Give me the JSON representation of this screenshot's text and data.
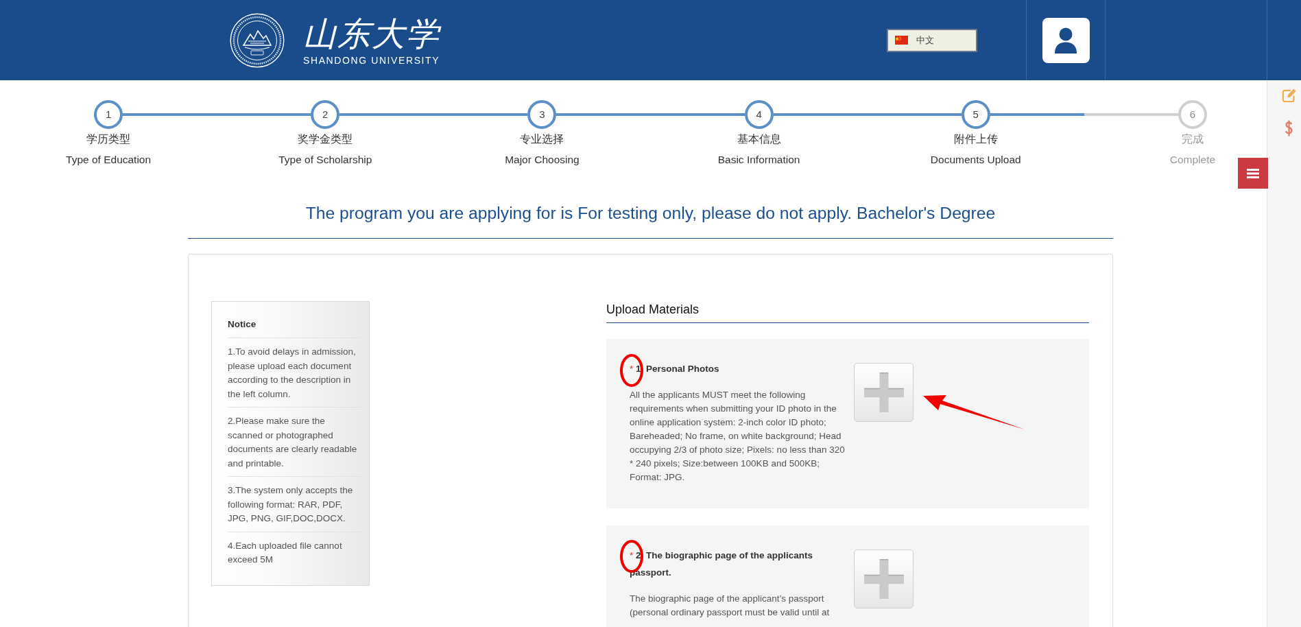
{
  "header": {
    "logo": {
      "name_zh": "山东大学",
      "name_en": "SHANDONG UNIVERSITY"
    },
    "language": {
      "label": "中文"
    }
  },
  "steps": [
    {
      "number": "1",
      "title_zh": "学历类型",
      "title_en": "Type of Education",
      "done": true
    },
    {
      "number": "2",
      "title_zh": "奖学金类型",
      "title_en": "Type of Scholarship",
      "done": true
    },
    {
      "number": "3",
      "title_zh": "专业选择",
      "title_en": "Major Choosing",
      "done": true
    },
    {
      "number": "4",
      "title_zh": "基本信息",
      "title_en": "Basic Information",
      "done": true
    },
    {
      "number": "5",
      "title_zh": "附件上传",
      "title_en": "Documents Upload",
      "done": true
    },
    {
      "number": "6",
      "title_zh": "完成",
      "title_en": "Complete",
      "done": false
    }
  ],
  "program_title": "The program you are applying for is For testing only, please do not apply. Bachelor's Degree",
  "notice": {
    "title": "Notice",
    "items": [
      "1.To avoid delays in admission, please upload each document according to the description in the left column.",
      "2.Please make sure the scanned or photographed documents are clearly readable and printable.",
      "3.The system only accepts the following format: RAR, PDF, JPG, PNG, GIF,DOC,DOCX.",
      "4.Each uploaded file cannot exceed 5M"
    ]
  },
  "upload": {
    "title": "Upload Materials",
    "items": [
      {
        "required_mark": "*",
        "title": "1. Personal Photos",
        "description": "All the applicants MUST meet the following requirements when submitting your ID photo in the online application system: 2-inch color ID photo; Bareheaded; No frame, on white background; Head occupying 2/3 of photo size; Pixels: no less than 320 * 240 pixels; Size:between 100KB and 500KB; Format: JPG.",
        "circled": true,
        "arrow": true
      },
      {
        "required_mark": "*",
        "title": "2. The biographic page of the applicants passport.",
        "description": "The biographic page of the applicant’s passport (personal ordinary passport must be valid until at",
        "circled": true,
        "arrow": false
      }
    ]
  }
}
